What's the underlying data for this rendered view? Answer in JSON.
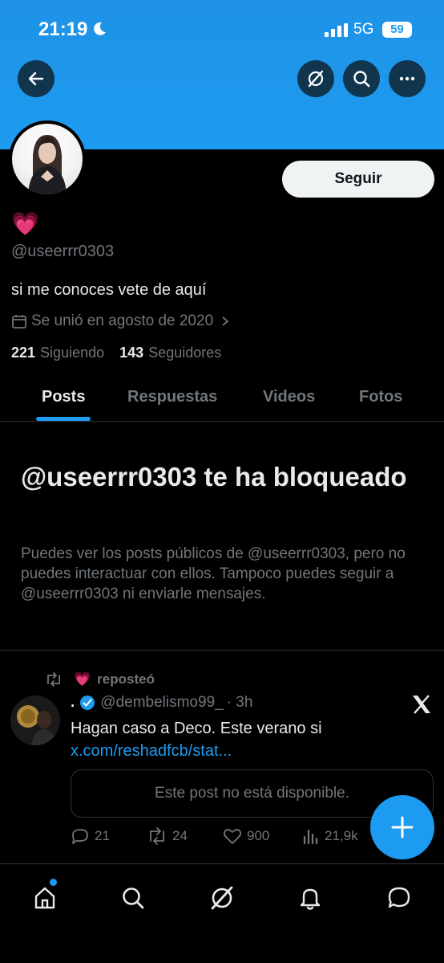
{
  "status_bar": {
    "time": "21:19",
    "network": "5G",
    "battery": "59"
  },
  "profile": {
    "display_name": "💗",
    "handle": "@useerrr0303",
    "bio": "si me conoces vete de aquí",
    "joined": "Se unió en agosto de 2020",
    "following_count": "221",
    "following_label": "Siguiendo",
    "followers_count": "143",
    "followers_label": "Seguidores",
    "follow_button": "Seguir"
  },
  "tabs": [
    {
      "label": "Posts",
      "active": true
    },
    {
      "label": "Respuestas",
      "active": false
    },
    {
      "label": "Videos",
      "active": false
    },
    {
      "label": "Fotos",
      "active": false
    }
  ],
  "blocked": {
    "title": "@useerrr0303 te ha bloqueado",
    "description": "Puedes ver los posts públicos de @useerrr0303, pero no puedes interactuar con ellos. Tampoco puedes seguir a @useerrr0303 ni enviarle mensajes."
  },
  "post": {
    "repost_emoji": "💗",
    "repost_label": "reposteó",
    "author_name": ".",
    "author_handle": "@dembelismo99_",
    "time": "· 3h",
    "text": "Hagan caso a Deco. Este verano si ",
    "link": "x.com/reshadfcb/stat...",
    "quoted_unavailable": "Este post no está disponible.",
    "replies": "21",
    "reposts": "24",
    "likes": "900",
    "views": "21,9k"
  },
  "colors": {
    "accent": "#1d9bf0",
    "background": "#000000",
    "muted": "#71767b",
    "heart": "#f46cb0"
  },
  "icons": [
    "back-arrow-icon",
    "grok-icon",
    "search-icon",
    "more-icon",
    "calendar-icon",
    "chevron-right-icon",
    "repost-icon",
    "verified-icon",
    "x-logo-icon",
    "reply-icon",
    "like-icon",
    "views-icon",
    "compose-plus-icon",
    "home-icon",
    "explore-icon",
    "notifications-icon",
    "messages-icon"
  ]
}
